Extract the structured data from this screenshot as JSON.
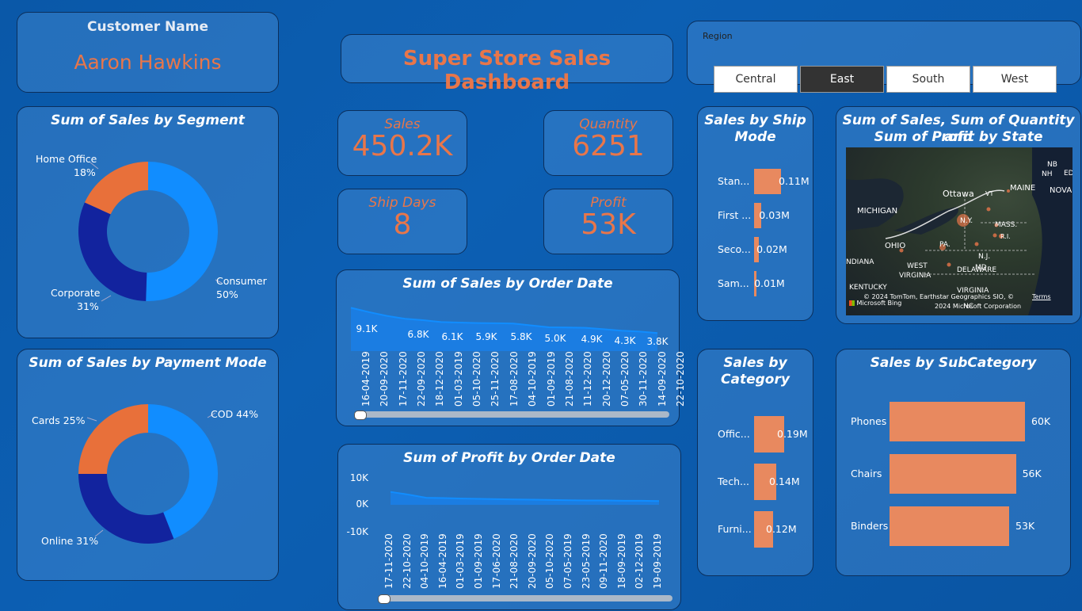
{
  "customer": {
    "title": "Customer Name",
    "name": "Aaron Hawkins"
  },
  "dashboard_title": "Super Store Sales Dashboard",
  "region": {
    "label": "Region",
    "options": [
      "Central",
      "East",
      "South",
      "West"
    ],
    "selected": "East"
  },
  "segment_chart": {
    "title": "Sum of Sales by Segment",
    "labels": {
      "home": "Home Office",
      "home_pct": "18%",
      "corp": "Corporate",
      "corp_pct": "31%",
      "cons": "Consumer",
      "cons_pct": "50%"
    }
  },
  "payment_chart": {
    "title": "Sum of Sales by Payment Mode",
    "labels": {
      "cards": "Cards 25%",
      "cod": "COD 44%",
      "online": "Online 31%"
    }
  },
  "kpis": {
    "sales_label": "Sales",
    "sales_value": "450.2K",
    "qty_label": "Quantity",
    "qty_value": "6251",
    "ship_label": "Ship Days",
    "ship_value": "8",
    "profit_label": "Profit",
    "profit_value": "53K"
  },
  "sales_date_chart": {
    "title": "Sum of Sales by Order Date"
  },
  "profit_date_chart": {
    "title": "Sum of Profit by Order Date"
  },
  "ship_mode_chart": {
    "title_1": "Sales by Ship",
    "title_2": "Mode"
  },
  "map": {
    "title_1": "Sum of Sales, Sum of Quantity and",
    "title_2": "Sum of Profit by State",
    "places": [
      "Ottawa",
      "MAINE",
      "MICHIGAN",
      "N.Y.",
      "MASS.",
      "OHIO",
      "PA.",
      "N.J.",
      "WEST",
      "VIRGINIA",
      "DELAWARE",
      "KENTUCKY",
      "NB",
      "NOVA",
      "VT",
      "NDIANA",
      "VIRGINIA",
      "NC",
      "R.I.",
      "MD",
      "ED",
      "NH"
    ],
    "credit_1": "© 2024 TomTom, Earthstar Geographics SIO, ©",
    "credit_terms": "Terms",
    "credit_2": "2024 Microsoft Corporation",
    "bing": "Microsoft Bing"
  },
  "category_chart": {
    "title_1": "Sales by",
    "title_2": "Category"
  },
  "subcategory_chart": {
    "title": "Sales by SubCategory"
  },
  "colors": {
    "accent": "#e8764a",
    "blue": "#118dff",
    "navy": "#12239e",
    "line": "#1a7fe8",
    "bar": "#e8895f"
  },
  "chart_data": [
    {
      "type": "pie",
      "title": "Sum of Sales by Segment",
      "categories": [
        "Consumer",
        "Corporate",
        "Home Office"
      ],
      "values": [
        50,
        31,
        18
      ]
    },
    {
      "type": "pie",
      "title": "Sum of Sales by Payment Mode",
      "categories": [
        "COD",
        "Online",
        "Cards"
      ],
      "values": [
        44,
        31,
        25
      ]
    },
    {
      "type": "area",
      "title": "Sum of Sales by Order Date",
      "x": [
        "16-04-2019",
        "20-09-2020",
        "17-11-2020",
        "22-09-2020",
        "18-12-2020",
        "01-03-2019",
        "05-10-2020",
        "25-11-2020",
        "17-08-2020",
        "04-10-2019",
        "01-09-2019",
        "21-08-2020",
        "11-12-2020",
        "20-12-2020",
        "07-05-2020",
        "30-11-2020",
        "14-09-2020",
        "22-10-2020"
      ],
      "values": [
        9.1,
        8.2,
        7.4,
        6.8,
        6.5,
        6.1,
        6.0,
        5.9,
        5.85,
        5.8,
        5.4,
        5.0,
        4.95,
        4.9,
        4.6,
        4.3,
        4.1,
        3.8
      ],
      "data_labels": [
        "9.1K",
        "6.8K",
        "6.1K",
        "5.9K",
        "5.8K",
        "5.0K",
        "4.9K",
        "4.3K",
        "3.8K"
      ]
    },
    {
      "type": "area",
      "title": "Sum of Profit by Order Date",
      "x": [
        "17-11-2020",
        "22-10-2020",
        "04-10-2019",
        "16-04-2019",
        "01-03-2019",
        "01-09-2019",
        "17-06-2020",
        "21-08-2020",
        "20-09-2020",
        "05-10-2020",
        "07-05-2019",
        "23-05-2019",
        "09-11-2020",
        "18-09-2019",
        "02-12-2019",
        "19-09-2019"
      ],
      "values": [
        4.8,
        3.8,
        2.6,
        2.5,
        2.3,
        2.2,
        2.1,
        2.0,
        1.9,
        1.8,
        1.7,
        1.6,
        1.6,
        1.5,
        1.5,
        1.4
      ],
      "yticks": [
        "10K",
        "0K",
        "-10K"
      ],
      "ylim": [
        -10,
        10
      ]
    },
    {
      "type": "bar",
      "title": "Sales by Ship Mode",
      "categories": [
        "Stan...",
        "First ...",
        "Seco...",
        "Sam..."
      ],
      "values": [
        0.11,
        0.03,
        0.02,
        0.01
      ],
      "data_labels": [
        "0.11M",
        "0.03M",
        "0.02M",
        "0.01M"
      ]
    },
    {
      "type": "bar",
      "title": "Sales by Category",
      "categories": [
        "Offic...",
        "Tech...",
        "Furni..."
      ],
      "values": [
        0.19,
        0.14,
        0.12
      ],
      "data_labels": [
        "0.19M",
        "0.14M",
        "0.12M"
      ]
    },
    {
      "type": "bar",
      "title": "Sales by SubCategory",
      "categories": [
        "Phones",
        "Chairs",
        "Binders"
      ],
      "values": [
        60,
        56,
        53
      ],
      "data_labels": [
        "60K",
        "56K",
        "53K"
      ]
    }
  ]
}
